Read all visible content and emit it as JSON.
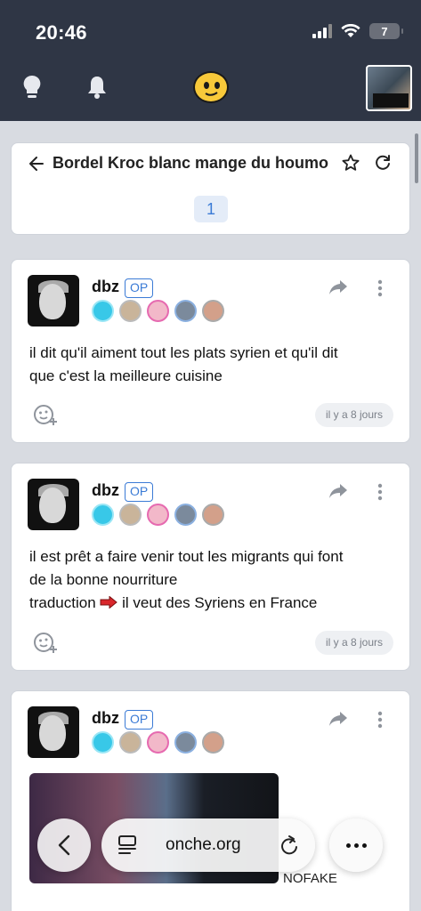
{
  "status_bar": {
    "time": "20:46",
    "battery": "7"
  },
  "topic": {
    "title": "Bordel Kroc blanc mange du houmo",
    "page": "1"
  },
  "posts": [
    {
      "author": "dbz",
      "badge": "OP",
      "text_lines": [
        "il dit qu'il aiment tout les plats syrien et qu'il dit",
        "que c'est la meilleure cuisine"
      ],
      "time": "il y a 8 jours"
    },
    {
      "author": "dbz",
      "badge": "OP",
      "text_lines": [
        "il est prêt a faire venir tout les migrants qui font",
        "de la bonne nourriture"
      ],
      "text_last_prefix": "traduction",
      "text_last_suffix": "il veut des Syriens en France",
      "time": "il y a 8 jours"
    },
    {
      "author": "dbz",
      "badge": "OP",
      "caption": "NOFAKE"
    }
  ],
  "browser": {
    "url": "onche.org"
  },
  "colors": {
    "header_bg": "#2f3645",
    "accent": "#3b7bd6",
    "page_bg": "#d8dbe1"
  }
}
